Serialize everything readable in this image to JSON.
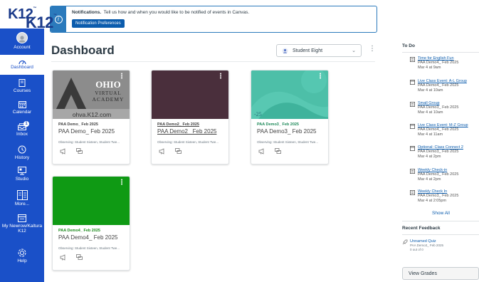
{
  "brand": {
    "logo_text": "K12",
    "logo_tm": "™",
    "accent": "#1a50c8",
    "link": "#0b5cad"
  },
  "nav": {
    "items": [
      {
        "label": "Account",
        "icon": "avatar"
      },
      {
        "label": "Dashboard",
        "icon": "dashboard-icon",
        "active": true
      },
      {
        "label": "Courses",
        "icon": "courses-icon"
      },
      {
        "label": "Calendar",
        "icon": "calendar-icon"
      },
      {
        "label": "Inbox",
        "icon": "inbox-icon",
        "badge": "1"
      },
      {
        "label": "History",
        "icon": "history-icon"
      },
      {
        "label": "Studio",
        "icon": "studio-icon"
      },
      {
        "label": "More...",
        "icon": "more-icon"
      },
      {
        "label": "My Newrow/Kaltura K12",
        "icon": "folder-icon"
      },
      {
        "label": "Help",
        "icon": "help-icon"
      }
    ]
  },
  "notification": {
    "title": "Notifications.",
    "message": "Tell us how and when you would like to be notified of events in Canvas.",
    "button": "Notification Preferences"
  },
  "dashboard": {
    "title": "Dashboard",
    "student_select": "Student Eight"
  },
  "cards": [
    {
      "hero_text_1": "OHIO",
      "hero_text_2": "VIRTUAL",
      "hero_text_3": "ACADEMY",
      "hero_url": "ohva.K12.com",
      "code": "PAA Demo_ Feb 2025",
      "name": "PAA Demo_ Feb 2025",
      "observing": "Observing: Student Sixteen, Student Twe...",
      "code_color": "#444444"
    },
    {
      "code": "PAA Demo2_ Feb 2025",
      "name": "PAA Demo2_ Feb 2025",
      "observing": "Observing: Student Sixteen, Student Twe...",
      "code_color": "#444444",
      "hero_color": "#4a2f3c"
    },
    {
      "code": "PAA Demo3_ Feb 2025",
      "name": "PAA Demo3_ Feb 2025",
      "observing": "Observing: Student Sixteen, Student Twe...",
      "code_color": "#1f8a5a",
      "hero_color": "#4dbfa8"
    },
    {
      "code": "PAA Demo4_ Feb 2025",
      "name": "PAA Demo4_ Feb 2025",
      "observing": "Observing: Student Sixteen, Student Twe...",
      "code_color": "#1c8a1c",
      "hero_color": "#0f9a14"
    }
  ],
  "todo": {
    "heading": "To Do",
    "items": [
      {
        "title": "Time for English Fun",
        "course": "PAA Demo4_ Feb 2025",
        "date": "Mar 4 at 9am"
      },
      {
        "title": "Live Class Event: A-L Group",
        "course": "PAA Demo4_ Feb 2025",
        "date": "Mar 4 at 10am"
      },
      {
        "title": "Small Group",
        "course": "PAA Demo3_ Feb 2025",
        "date": "Mar 4 at 10am"
      },
      {
        "title": "Live Class Event: M-Z Group",
        "course": "PAA Demo4_ Feb 2025",
        "date": "Mar 4 at 11am"
      },
      {
        "title": "Optional: Class Connect 2",
        "course": "PAA Demo3_ Feb 2025",
        "date": "Mar 4 at 2pm"
      },
      {
        "title": "Weekly Check-in",
        "course": "PAA Demo3_ Feb 2025",
        "date": "Mar 4 at 2pm"
      },
      {
        "title": "Weekly Check In",
        "course": "PAA Demo3_ Feb 2025",
        "date": "Mar 4 at 2:05pm"
      }
    ],
    "show_all": "Show All"
  },
  "feedback": {
    "heading": "Recent Feedback",
    "title": "Unnamed Quiz",
    "course": "PAA Demo3_ Feb 2025",
    "score": "0 out of 0"
  },
  "view_grades": "View Grades"
}
